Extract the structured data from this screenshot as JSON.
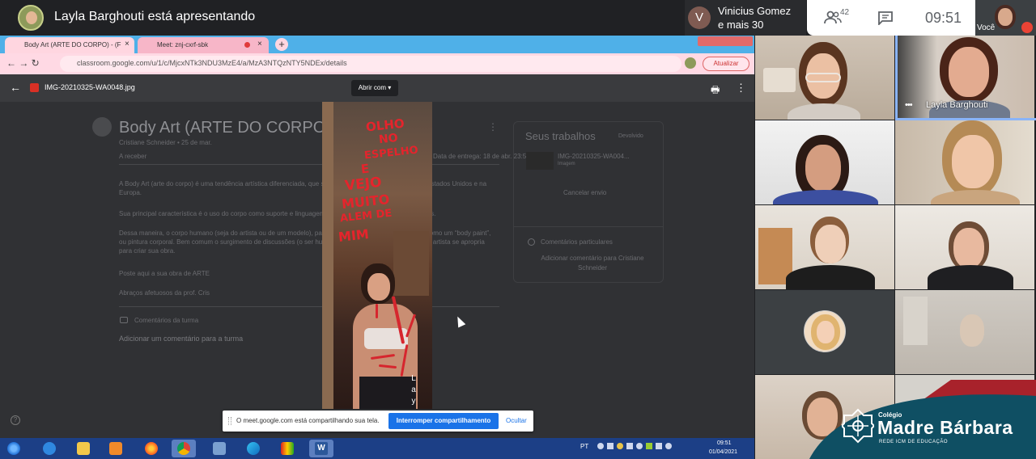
{
  "meet": {
    "presenting_text": "Layla Barghouti está apresentando",
    "joined_initial": "V",
    "joined_name": "Vinicius Gomez",
    "joined_more": "e mais 30",
    "people_count": "42",
    "clock": "09:51",
    "self_label": "Você",
    "speaker_name": "Layla Barghouti"
  },
  "browser": {
    "tabs": [
      {
        "label": "Body Art (ARTE DO CORPO) - (F"
      },
      {
        "label": "Meet: znj-cxrf-sbk"
      }
    ],
    "tab_close": "×",
    "new_tab": "+",
    "url": "classroom.google.com/u/1/c/MjcxNTk3NDU3MzE4/a/MzA3NTQzNTY5NDEx/details",
    "update_label": "Atualizar"
  },
  "drive_viewer": {
    "filename": "IMG-20210325-WA0048.jpg",
    "open_with": "Abrir com ▾"
  },
  "classroom": {
    "title": "Body Art (ARTE DO CORPO)",
    "meta": "Cristiane Schneider • 25 de mar.",
    "points": "A receber",
    "due": "Data de entrega: 18 de abr. 23:59",
    "paragraphs": [
      "A Body Art (arte do corpo) é uma tendência artística diferenciada, que surgiu nos anos 60 na Europa e nos Estados Unidos e na Europa.",
      "Sua principal característica é o uso do corpo como suporte e linguagem de expressão dos trabalhos artísticos.",
      "Dessa maneira, o corpo humano (seja do artista ou de um modelo), passa a ser o próprio suporte da obra, como um “body paint”, ou pintura corporal. Bem comum o surgimento de discussões (o ser humano e a sociedade) desta maneira o artista se apropria para criar sua obra.",
      "Poste aqui a sua obra de ARTE",
      "Abraços afetuosos da prof. Cris"
    ],
    "class_comments": "Comentários da turma",
    "add_class_comment": "Adicionar um comentário para a turma",
    "work_title": "Seus trabalhos",
    "work_status": "Devolvido",
    "work_file": "IMG-20210325-WA004...",
    "work_type": "Imagem",
    "cancel_submission": "Cancelar envio",
    "private_comments": "Comentários particulares",
    "add_private_comment": "Adicionar comentário para Cristiane Schneider"
  },
  "artwork_text": {
    "line1": "OLHO",
    "line2": "NO",
    "line3": "ESPELHO",
    "line4": "E",
    "line5": "VEJO",
    "line6": "MUITO",
    "line7": "ALEM DE",
    "line8": "MIM",
    "signature": "L a y"
  },
  "share_notice": {
    "text": "O meet.google.com está compartilhando sua tela.",
    "stop": "Interromper compartilhamento",
    "hide": "Ocultar"
  },
  "taskbar": {
    "lang": "PT",
    "time": "09:51",
    "date": "01/04/2021",
    "word_letter": "W"
  },
  "logo": {
    "colegio": "Colégio",
    "name": "Madre Bárbara",
    "sub": "REDE ICM DE EDUCAÇÃO"
  },
  "icons": {
    "back": "←",
    "forward": "→",
    "reload": "↻",
    "print": "🖶",
    "more": "⋮",
    "help": "?",
    "speaker_dots": "•••",
    "nav_combo": "←  →  ↻"
  },
  "colors": {
    "meet_bg": "#202124",
    "accent_blue": "#1a73e8",
    "speaker_ring": "#8ab4f8",
    "logo_teal": "#0f4f63",
    "logo_red": "#a8222b",
    "taskbar": "#1c3f86"
  }
}
